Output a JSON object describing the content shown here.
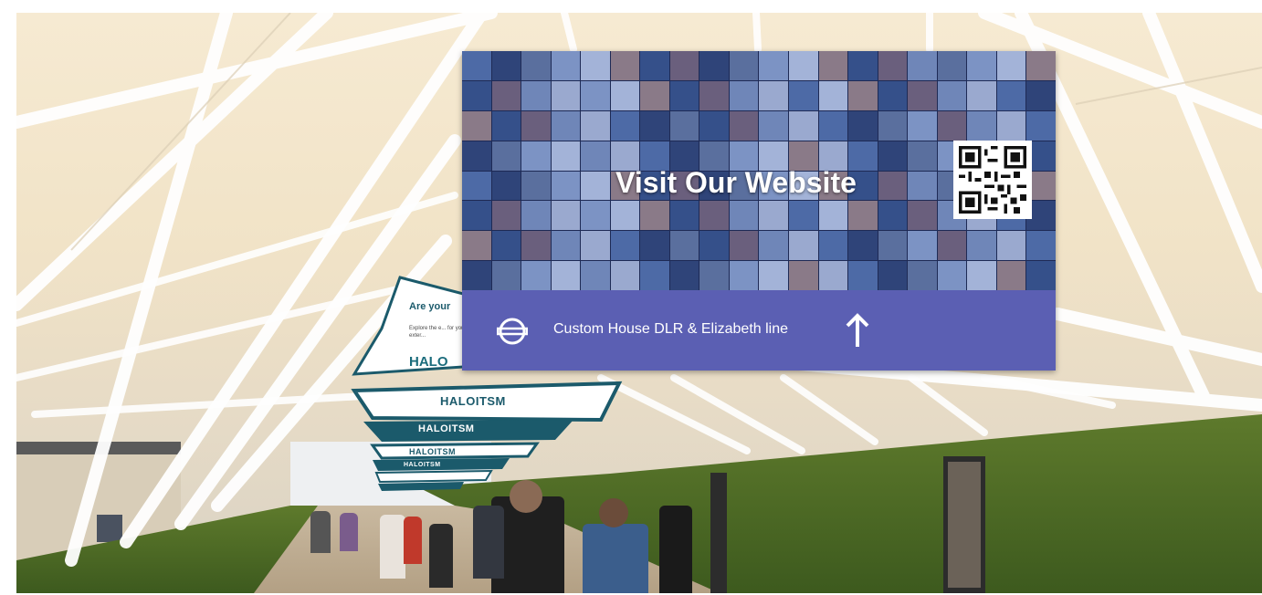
{
  "scene": {
    "description_tag": "photo-walkway-billboard"
  },
  "billboard": {
    "headline": "Visit Our Website",
    "direction_text": "Custom House DLR & Elizabeth line",
    "logo_icon": "tfl-roundel-icon",
    "arrow_icon": "arrow-up-icon",
    "qr_icon": "qr-code-icon",
    "bar_color": "#5b5fb3"
  },
  "banners": {
    "main_line1": "Are your",
    "main_line2": "Explore the e... for your exter...",
    "main_brand": "HALO",
    "repeated_brand": "HALOITSM"
  }
}
